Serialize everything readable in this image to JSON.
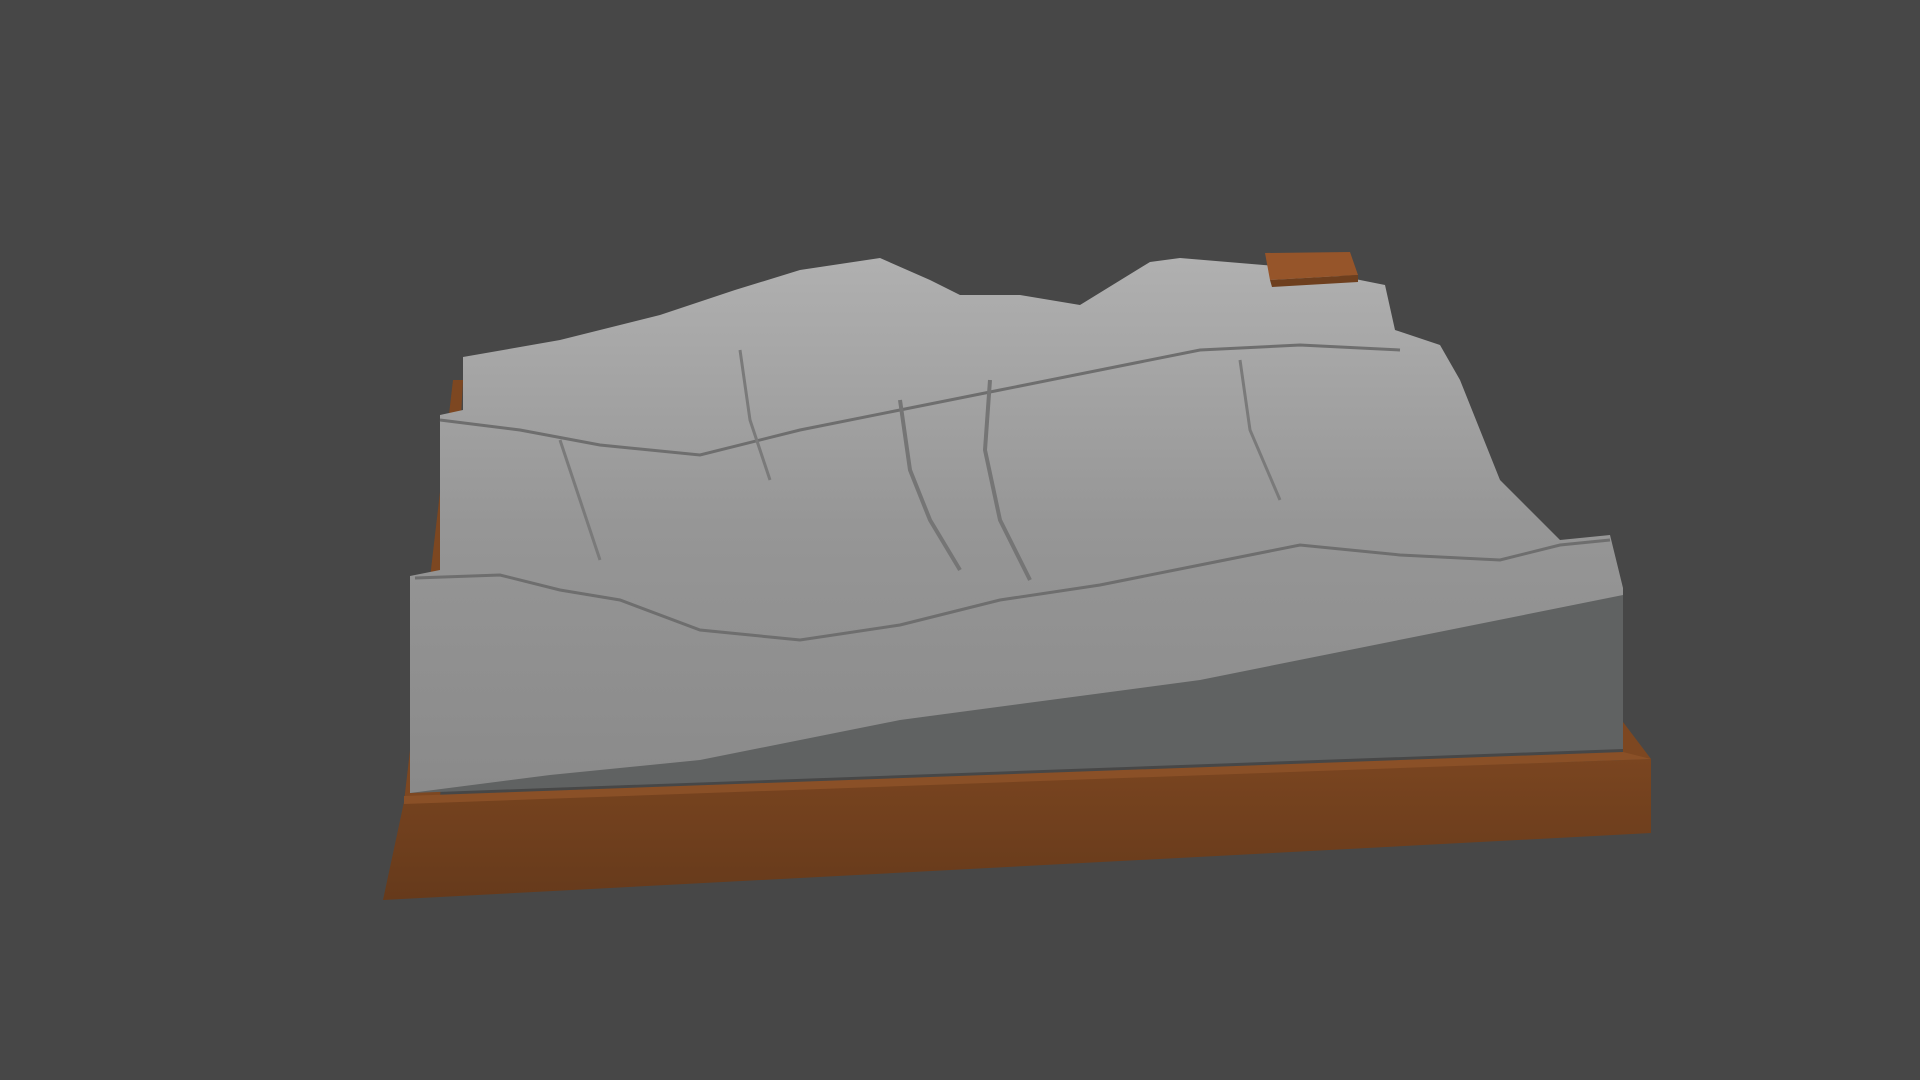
{
  "scene": {
    "subject": "terrain-relief-model",
    "colors": {
      "background": "#474747",
      "terrain": "#9a9a9a",
      "terrain_front_face": "#606262",
      "wood_base": "#6e3f1e",
      "wood_top": "#8a4f25"
    }
  }
}
